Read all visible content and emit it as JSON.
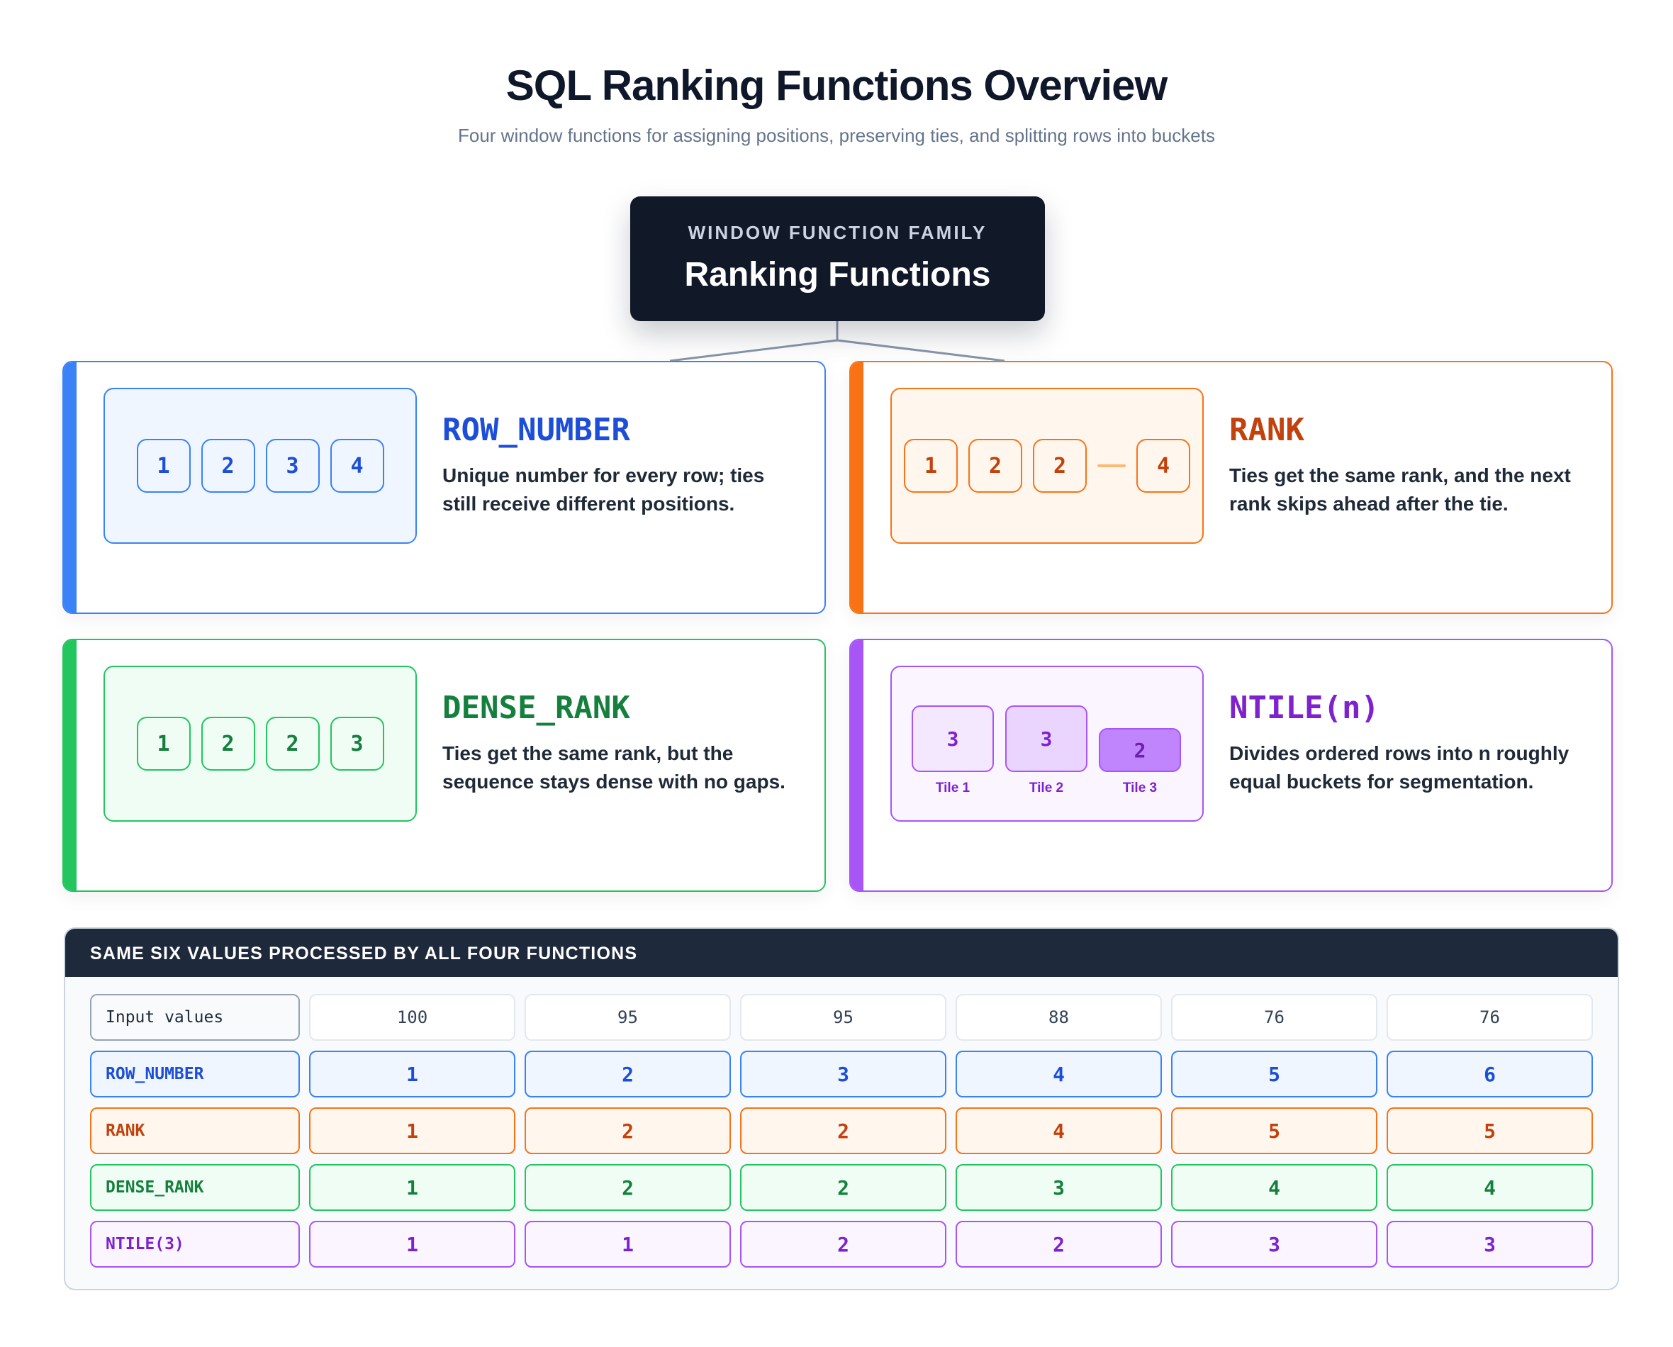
{
  "header": {
    "title": "SQL Ranking Functions Overview",
    "subtitle": "Four window functions for assigning positions, preserving ties, and splitting rows into buckets"
  },
  "family": {
    "eyebrow": "WINDOW FUNCTION FAMILY",
    "name": "Ranking Functions"
  },
  "cards": {
    "row_number": {
      "name": "ROW_NUMBER",
      "description": "Unique number for every row; ties still receive different positions.",
      "chips": [
        "1",
        "2",
        "3",
        "4"
      ]
    },
    "rank": {
      "name": "RANK",
      "description": "Ties get the same rank, and the next rank skips ahead after the tie.",
      "chips": [
        "1",
        "2",
        "2",
        "4"
      ]
    },
    "dense_rank": {
      "name": "DENSE_RANK",
      "description": "Ties get the same rank, but the sequence stays dense with no gaps.",
      "chips": [
        "1",
        "2",
        "2",
        "3"
      ]
    },
    "ntile": {
      "name": "NTILE(n)",
      "description": "Divides ordered rows into n roughly equal buckets for segmentation.",
      "tiles": [
        {
          "count": "3",
          "label": "Tile 1"
        },
        {
          "count": "3",
          "label": "Tile 2"
        },
        {
          "count": "2",
          "label": "Tile 3"
        }
      ]
    }
  },
  "example": {
    "heading": "SAME SIX VALUES PROCESSED BY ALL FOUR FUNCTIONS",
    "rows": [
      {
        "label": "Input values",
        "values": [
          "100",
          "95",
          "95",
          "88",
          "76",
          "76"
        ]
      },
      {
        "label": "ROW_NUMBER",
        "values": [
          "1",
          "2",
          "3",
          "4",
          "5",
          "6"
        ]
      },
      {
        "label": "RANK",
        "values": [
          "1",
          "2",
          "2",
          "4",
          "5",
          "5"
        ]
      },
      {
        "label": "DENSE_RANK",
        "values": [
          "1",
          "2",
          "2",
          "3",
          "4",
          "4"
        ]
      },
      {
        "label": "NTILE(3)",
        "values": [
          "1",
          "1",
          "2",
          "2",
          "3",
          "3"
        ]
      }
    ]
  },
  "colors": {
    "row_number": "#3b82f6",
    "rank": "#f97316",
    "dense_rank": "#22c55e",
    "ntile": "#a855f7",
    "dark": "#111827"
  }
}
